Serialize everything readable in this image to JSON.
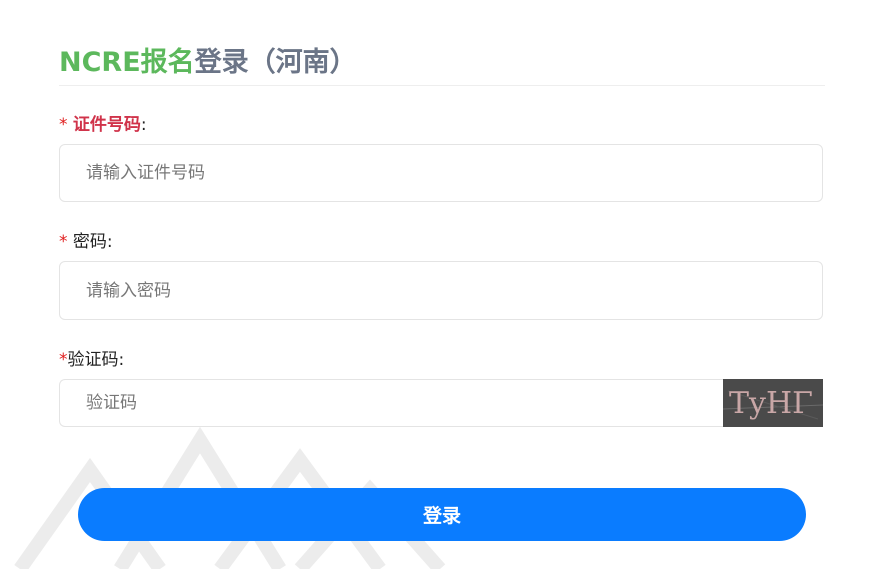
{
  "header": {
    "title_brand": "NCRE报名",
    "title_rest": "登录（河南）"
  },
  "form": {
    "id_number": {
      "required_mark": "*",
      "label": "证件号码",
      "colon": ":",
      "placeholder": "请输入证件号码",
      "value": ""
    },
    "password": {
      "required_mark": "*",
      "label": "密码",
      "colon": ":",
      "placeholder": "请输入密码",
      "value": ""
    },
    "captcha": {
      "required_mark": "*",
      "label": "验证码",
      "colon": ":",
      "placeholder": "验证码",
      "value": "",
      "image_text": "TyHΓ"
    },
    "submit_label": "登录"
  },
  "colors": {
    "brand_green": "#5cb85c",
    "title_gray": "#6b7587",
    "required_red": "#e02020",
    "primary_blue": "#0a7cff"
  }
}
